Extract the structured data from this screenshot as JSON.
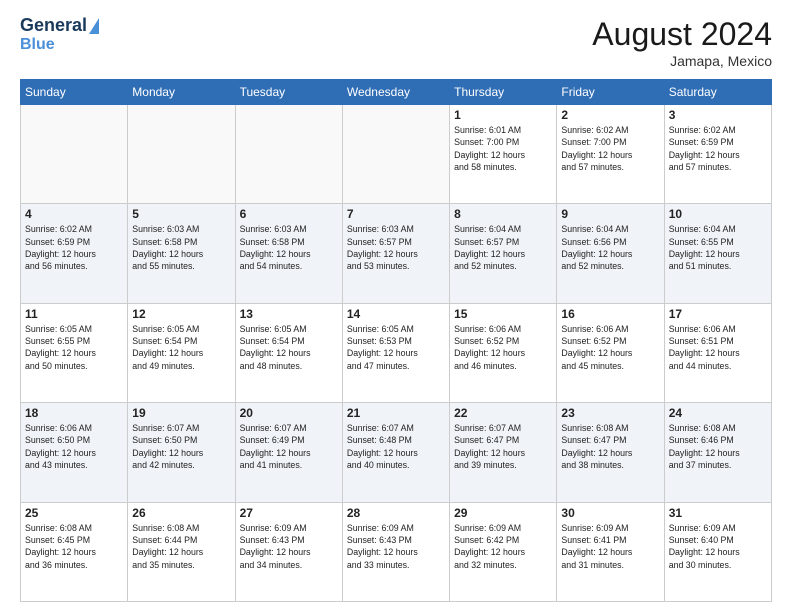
{
  "header": {
    "logo_line1": "General",
    "logo_line2": "Blue",
    "month_year": "August 2024",
    "location": "Jamapa, Mexico"
  },
  "days_of_week": [
    "Sunday",
    "Monday",
    "Tuesday",
    "Wednesday",
    "Thursday",
    "Friday",
    "Saturday"
  ],
  "weeks": [
    {
      "alt": false,
      "days": [
        {
          "num": "",
          "info": ""
        },
        {
          "num": "",
          "info": ""
        },
        {
          "num": "",
          "info": ""
        },
        {
          "num": "",
          "info": ""
        },
        {
          "num": "1",
          "info": "Sunrise: 6:01 AM\nSunset: 7:00 PM\nDaylight: 12 hours\nand 58 minutes."
        },
        {
          "num": "2",
          "info": "Sunrise: 6:02 AM\nSunset: 7:00 PM\nDaylight: 12 hours\nand 57 minutes."
        },
        {
          "num": "3",
          "info": "Sunrise: 6:02 AM\nSunset: 6:59 PM\nDaylight: 12 hours\nand 57 minutes."
        }
      ]
    },
    {
      "alt": true,
      "days": [
        {
          "num": "4",
          "info": "Sunrise: 6:02 AM\nSunset: 6:59 PM\nDaylight: 12 hours\nand 56 minutes."
        },
        {
          "num": "5",
          "info": "Sunrise: 6:03 AM\nSunset: 6:58 PM\nDaylight: 12 hours\nand 55 minutes."
        },
        {
          "num": "6",
          "info": "Sunrise: 6:03 AM\nSunset: 6:58 PM\nDaylight: 12 hours\nand 54 minutes."
        },
        {
          "num": "7",
          "info": "Sunrise: 6:03 AM\nSunset: 6:57 PM\nDaylight: 12 hours\nand 53 minutes."
        },
        {
          "num": "8",
          "info": "Sunrise: 6:04 AM\nSunset: 6:57 PM\nDaylight: 12 hours\nand 52 minutes."
        },
        {
          "num": "9",
          "info": "Sunrise: 6:04 AM\nSunset: 6:56 PM\nDaylight: 12 hours\nand 52 minutes."
        },
        {
          "num": "10",
          "info": "Sunrise: 6:04 AM\nSunset: 6:55 PM\nDaylight: 12 hours\nand 51 minutes."
        }
      ]
    },
    {
      "alt": false,
      "days": [
        {
          "num": "11",
          "info": "Sunrise: 6:05 AM\nSunset: 6:55 PM\nDaylight: 12 hours\nand 50 minutes."
        },
        {
          "num": "12",
          "info": "Sunrise: 6:05 AM\nSunset: 6:54 PM\nDaylight: 12 hours\nand 49 minutes."
        },
        {
          "num": "13",
          "info": "Sunrise: 6:05 AM\nSunset: 6:54 PM\nDaylight: 12 hours\nand 48 minutes."
        },
        {
          "num": "14",
          "info": "Sunrise: 6:05 AM\nSunset: 6:53 PM\nDaylight: 12 hours\nand 47 minutes."
        },
        {
          "num": "15",
          "info": "Sunrise: 6:06 AM\nSunset: 6:52 PM\nDaylight: 12 hours\nand 46 minutes."
        },
        {
          "num": "16",
          "info": "Sunrise: 6:06 AM\nSunset: 6:52 PM\nDaylight: 12 hours\nand 45 minutes."
        },
        {
          "num": "17",
          "info": "Sunrise: 6:06 AM\nSunset: 6:51 PM\nDaylight: 12 hours\nand 44 minutes."
        }
      ]
    },
    {
      "alt": true,
      "days": [
        {
          "num": "18",
          "info": "Sunrise: 6:06 AM\nSunset: 6:50 PM\nDaylight: 12 hours\nand 43 minutes."
        },
        {
          "num": "19",
          "info": "Sunrise: 6:07 AM\nSunset: 6:50 PM\nDaylight: 12 hours\nand 42 minutes."
        },
        {
          "num": "20",
          "info": "Sunrise: 6:07 AM\nSunset: 6:49 PM\nDaylight: 12 hours\nand 41 minutes."
        },
        {
          "num": "21",
          "info": "Sunrise: 6:07 AM\nSunset: 6:48 PM\nDaylight: 12 hours\nand 40 minutes."
        },
        {
          "num": "22",
          "info": "Sunrise: 6:07 AM\nSunset: 6:47 PM\nDaylight: 12 hours\nand 39 minutes."
        },
        {
          "num": "23",
          "info": "Sunrise: 6:08 AM\nSunset: 6:47 PM\nDaylight: 12 hours\nand 38 minutes."
        },
        {
          "num": "24",
          "info": "Sunrise: 6:08 AM\nSunset: 6:46 PM\nDaylight: 12 hours\nand 37 minutes."
        }
      ]
    },
    {
      "alt": false,
      "days": [
        {
          "num": "25",
          "info": "Sunrise: 6:08 AM\nSunset: 6:45 PM\nDaylight: 12 hours\nand 36 minutes."
        },
        {
          "num": "26",
          "info": "Sunrise: 6:08 AM\nSunset: 6:44 PM\nDaylight: 12 hours\nand 35 minutes."
        },
        {
          "num": "27",
          "info": "Sunrise: 6:09 AM\nSunset: 6:43 PM\nDaylight: 12 hours\nand 34 minutes."
        },
        {
          "num": "28",
          "info": "Sunrise: 6:09 AM\nSunset: 6:43 PM\nDaylight: 12 hours\nand 33 minutes."
        },
        {
          "num": "29",
          "info": "Sunrise: 6:09 AM\nSunset: 6:42 PM\nDaylight: 12 hours\nand 32 minutes."
        },
        {
          "num": "30",
          "info": "Sunrise: 6:09 AM\nSunset: 6:41 PM\nDaylight: 12 hours\nand 31 minutes."
        },
        {
          "num": "31",
          "info": "Sunrise: 6:09 AM\nSunset: 6:40 PM\nDaylight: 12 hours\nand 30 minutes."
        }
      ]
    }
  ]
}
